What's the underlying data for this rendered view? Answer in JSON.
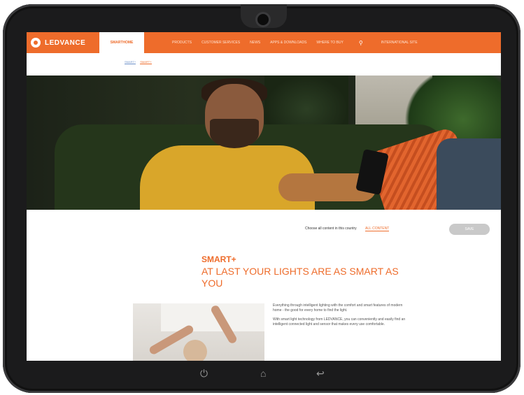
{
  "nav": {
    "brand": "LEDVANCE",
    "active_tab": "SMARTHOME",
    "links": [
      "PRODUCTS",
      "CUSTOMER SERVICES",
      "NEWS",
      "APPS & DOWNLOADS",
      "WHERE TO BUY"
    ],
    "region": "INTERNATIONAL SITE"
  },
  "subnav": {
    "links": [
      "SMART+",
      "SMART+"
    ]
  },
  "filter": {
    "label": "Choose all content in this country",
    "value": "ALL CONTENT",
    "button": "SAVE"
  },
  "content": {
    "title": "SMART+",
    "headline": "AT LAST YOUR LIGHTS ARE AS SMART AS YOU",
    "paragraphs": [
      "Everything through intelligent lighting with the comfort and smart features of modern home - the good for every home to find the light.",
      "With smart light technology from LEDVANCE, you can conveniently and easily find an intelligent connected light and sensor that makes every use comfortable."
    ]
  },
  "device": {
    "buttons": [
      "power",
      "home",
      "back"
    ]
  },
  "colors": {
    "accent": "#ee6c2b"
  }
}
